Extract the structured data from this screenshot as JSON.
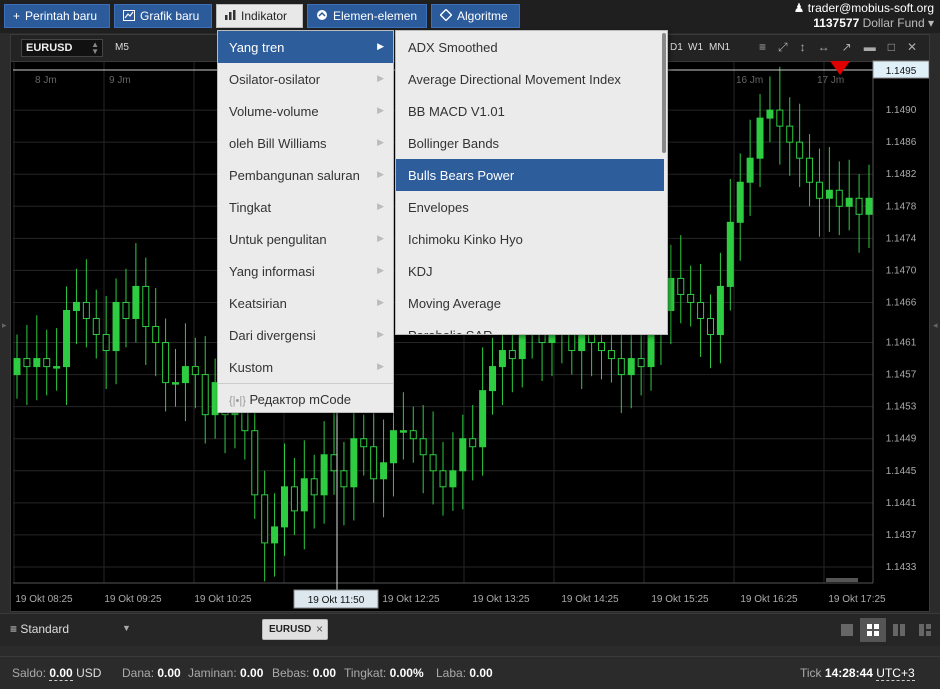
{
  "toolbar": {
    "new_order": "Perintah baru",
    "new_chart": "Grafik baru",
    "indicator": "Indikator",
    "elements": "Elemen-elemen",
    "algorithm": "Algoritme"
  },
  "account": {
    "email": "trader@mobius-soft.org",
    "number": "1137577",
    "fund": "Dollar Fund"
  },
  "chart": {
    "symbol": "EURUSD",
    "timeframe": "M5",
    "periods": [
      "D1",
      "W1",
      "MN1"
    ],
    "current_price": "1.1495",
    "crosshair_time": "19 Okt 11:50"
  },
  "chart_data": {
    "type": "candlestick",
    "x_ticks": [
      "19 Okt 08:25",
      "19 Okt 09:25",
      "19 Okt 10:25",
      "19 Okt 11:50",
      "19 Okt 12:25",
      "19 Okt 13:25",
      "19 Okt 14:25",
      "19 Okt 15:25",
      "19 Okt 16:25",
      "19 Okt 17:25"
    ],
    "y_ticks": [
      "1.1490",
      "1.1486",
      "1.1482",
      "1.1478",
      "1.1474",
      "1.1470",
      "1.1466",
      "1.1461",
      "1.1457",
      "1.1453",
      "1.1449",
      "1.1445",
      "1.1441",
      "1.1437",
      "1.1433"
    ],
    "ylim": [
      1.1431,
      1.1496
    ],
    "period_labels": [
      "8 Jm",
      "9 Jm",
      "16 Jm",
      "17 Jm"
    ],
    "up_color": "#2ecc40",
    "close": [
      1.1459,
      1.1458,
      1.1459,
      1.1458,
      1.1458,
      1.1465,
      1.1466,
      1.1464,
      1.1462,
      1.146,
      1.1466,
      1.1464,
      1.1468,
      1.1463,
      1.1461,
      1.1456,
      1.1456,
      1.1458,
      1.1457,
      1.1452,
      1.1456,
      1.1452,
      1.1454,
      1.145,
      1.1442,
      1.1436,
      1.1438,
      1.1443,
      1.144,
      1.1444,
      1.1442,
      1.1447,
      1.1445,
      1.1443,
      1.1449,
      1.1448,
      1.1444,
      1.1446,
      1.145,
      1.145,
      1.1449,
      1.1447,
      1.1445,
      1.1443,
      1.1445,
      1.1449,
      1.1448,
      1.1455,
      1.1458,
      1.146,
      1.1459,
      1.1462,
      1.1463,
      1.1461,
      1.1463,
      1.1462,
      1.146,
      1.1462,
      1.1461,
      1.146,
      1.1459,
      1.1457,
      1.1459,
      1.1458,
      1.1463,
      1.1465,
      1.1469,
      1.1467,
      1.1466,
      1.1464,
      1.1462,
      1.1468,
      1.1476,
      1.1481,
      1.1484,
      1.1489,
      1.149,
      1.1488,
      1.1486,
      1.1484,
      1.1481,
      1.1479,
      1.148,
      1.1478,
      1.1479,
      1.1477,
      1.1479
    ]
  },
  "menu_level1": {
    "items": [
      {
        "label": "Yang tren",
        "selected": true
      },
      {
        "label": "Osilator-osilator"
      },
      {
        "label": "Volume-volume"
      },
      {
        "label": "oleh Bill Williams"
      },
      {
        "label": "Pembangunan saluran"
      },
      {
        "label": "Tingkat"
      },
      {
        "label": "Untuk pengulitan"
      },
      {
        "label": "Yang informasi"
      },
      {
        "label": "Keatsirian"
      },
      {
        "label": "Dari divergensi"
      },
      {
        "label": "Kustom"
      }
    ],
    "editor": "Редактор mCode"
  },
  "menu_level2": {
    "items": [
      {
        "label": "ADX Smoothed"
      },
      {
        "label": "Average Directional Movement Index"
      },
      {
        "label": "BB MACD V1.01"
      },
      {
        "label": "Bollinger Bands"
      },
      {
        "label": "Bulls Bears Power",
        "selected": true
      },
      {
        "label": "Envelopes"
      },
      {
        "label": "Ichimoku Kinko Hyo"
      },
      {
        "label": "KDJ"
      },
      {
        "label": "Moving Average"
      },
      {
        "label": "Parabolic SAR"
      }
    ]
  },
  "tabs": {
    "layout": "Standard",
    "symbol_tab": "EURUSD"
  },
  "status": {
    "saldo_label": "Saldo:",
    "saldo_value": "0.00",
    "saldo_cur": "USD",
    "dana_label": "Dana:",
    "dana_value": "0.00",
    "jaminan_label": "Jaminan:",
    "jaminan_value": "0.00",
    "bebas_label": "Bebas:",
    "bebas_value": "0.00",
    "tingkat_label": "Tingkat:",
    "tingkat_value": "0.00%",
    "laba_label": "Laba:",
    "laba_value": "0.00",
    "tick_label": "Tick",
    "time": "14:28:44",
    "tz": "UTC+3"
  }
}
